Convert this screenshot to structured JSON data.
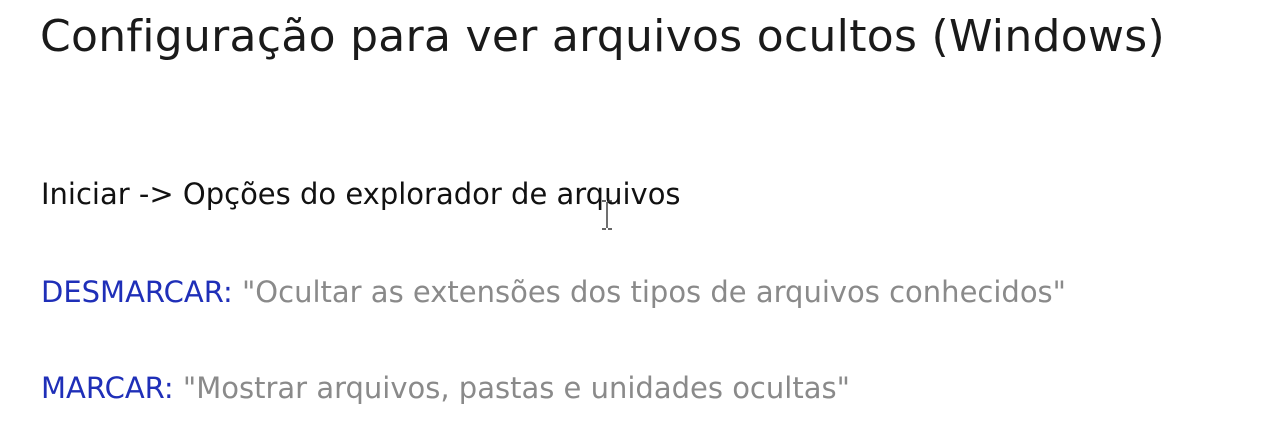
{
  "slide": {
    "title": "Configuração para ver arquivos ocultos (Windows)",
    "navigation_path": "Iniciar -> Opções do explorador de arquivos",
    "uncheck": {
      "label": "DESMARCAR:",
      "option": "\"Ocultar as extensões dos tipos de arquivos conhecidos\""
    },
    "check": {
      "label": "MARCAR:",
      "option": "\"Mostrar arquivos, pastas e unidades ocultas\""
    }
  },
  "colors": {
    "keyword": "#1f2fb8",
    "quoted_option": "#8a8a8a",
    "body_text": "#111111"
  },
  "icons": {
    "cursor": "text-ibeam-cursor-icon"
  }
}
